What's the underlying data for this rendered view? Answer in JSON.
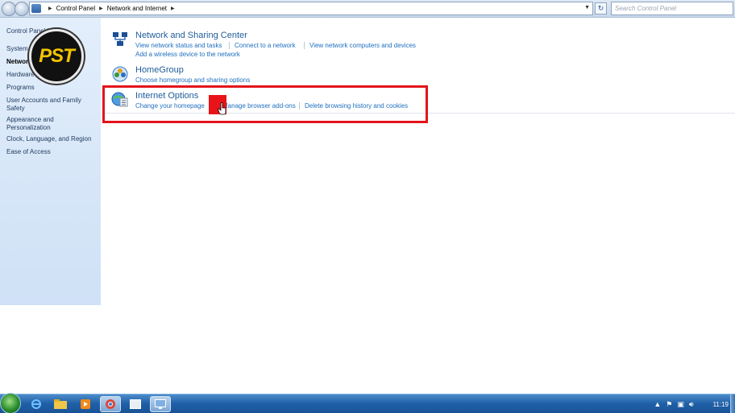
{
  "addressbar": {
    "breadcrumb": [
      "Control Panel",
      "Network and Internet"
    ],
    "search_placeholder": "Search Control Panel"
  },
  "leftpane": {
    "items": [
      "Control Panel Home",
      "System and Security",
      "Network and Internet",
      "Hardware and Sound",
      "Programs",
      "User Accounts and Family",
      "Safety",
      "Appearance and",
      "Personalization",
      "Clock, Language, and Region",
      "Ease of Access"
    ],
    "logo_text": "PST"
  },
  "categories": {
    "network": {
      "title": "Network and Sharing Center",
      "links": [
        "View network status and tasks",
        "Connect to a network",
        "View network computers and devices",
        "Add a wireless device to the network"
      ]
    },
    "homegroup": {
      "title": "HomeGroup",
      "links": [
        "Choose homegroup and sharing options"
      ]
    },
    "internet": {
      "title": "Internet Options",
      "links": [
        "Change your homepage",
        "Manage browser add-ons",
        "Delete browsing history and cookies"
      ]
    }
  },
  "taskbar": {
    "clock": "11:19"
  },
  "colors": {
    "link": "#1f6fbf",
    "title": "#1e5d9a",
    "highlight": "#e3141b"
  }
}
